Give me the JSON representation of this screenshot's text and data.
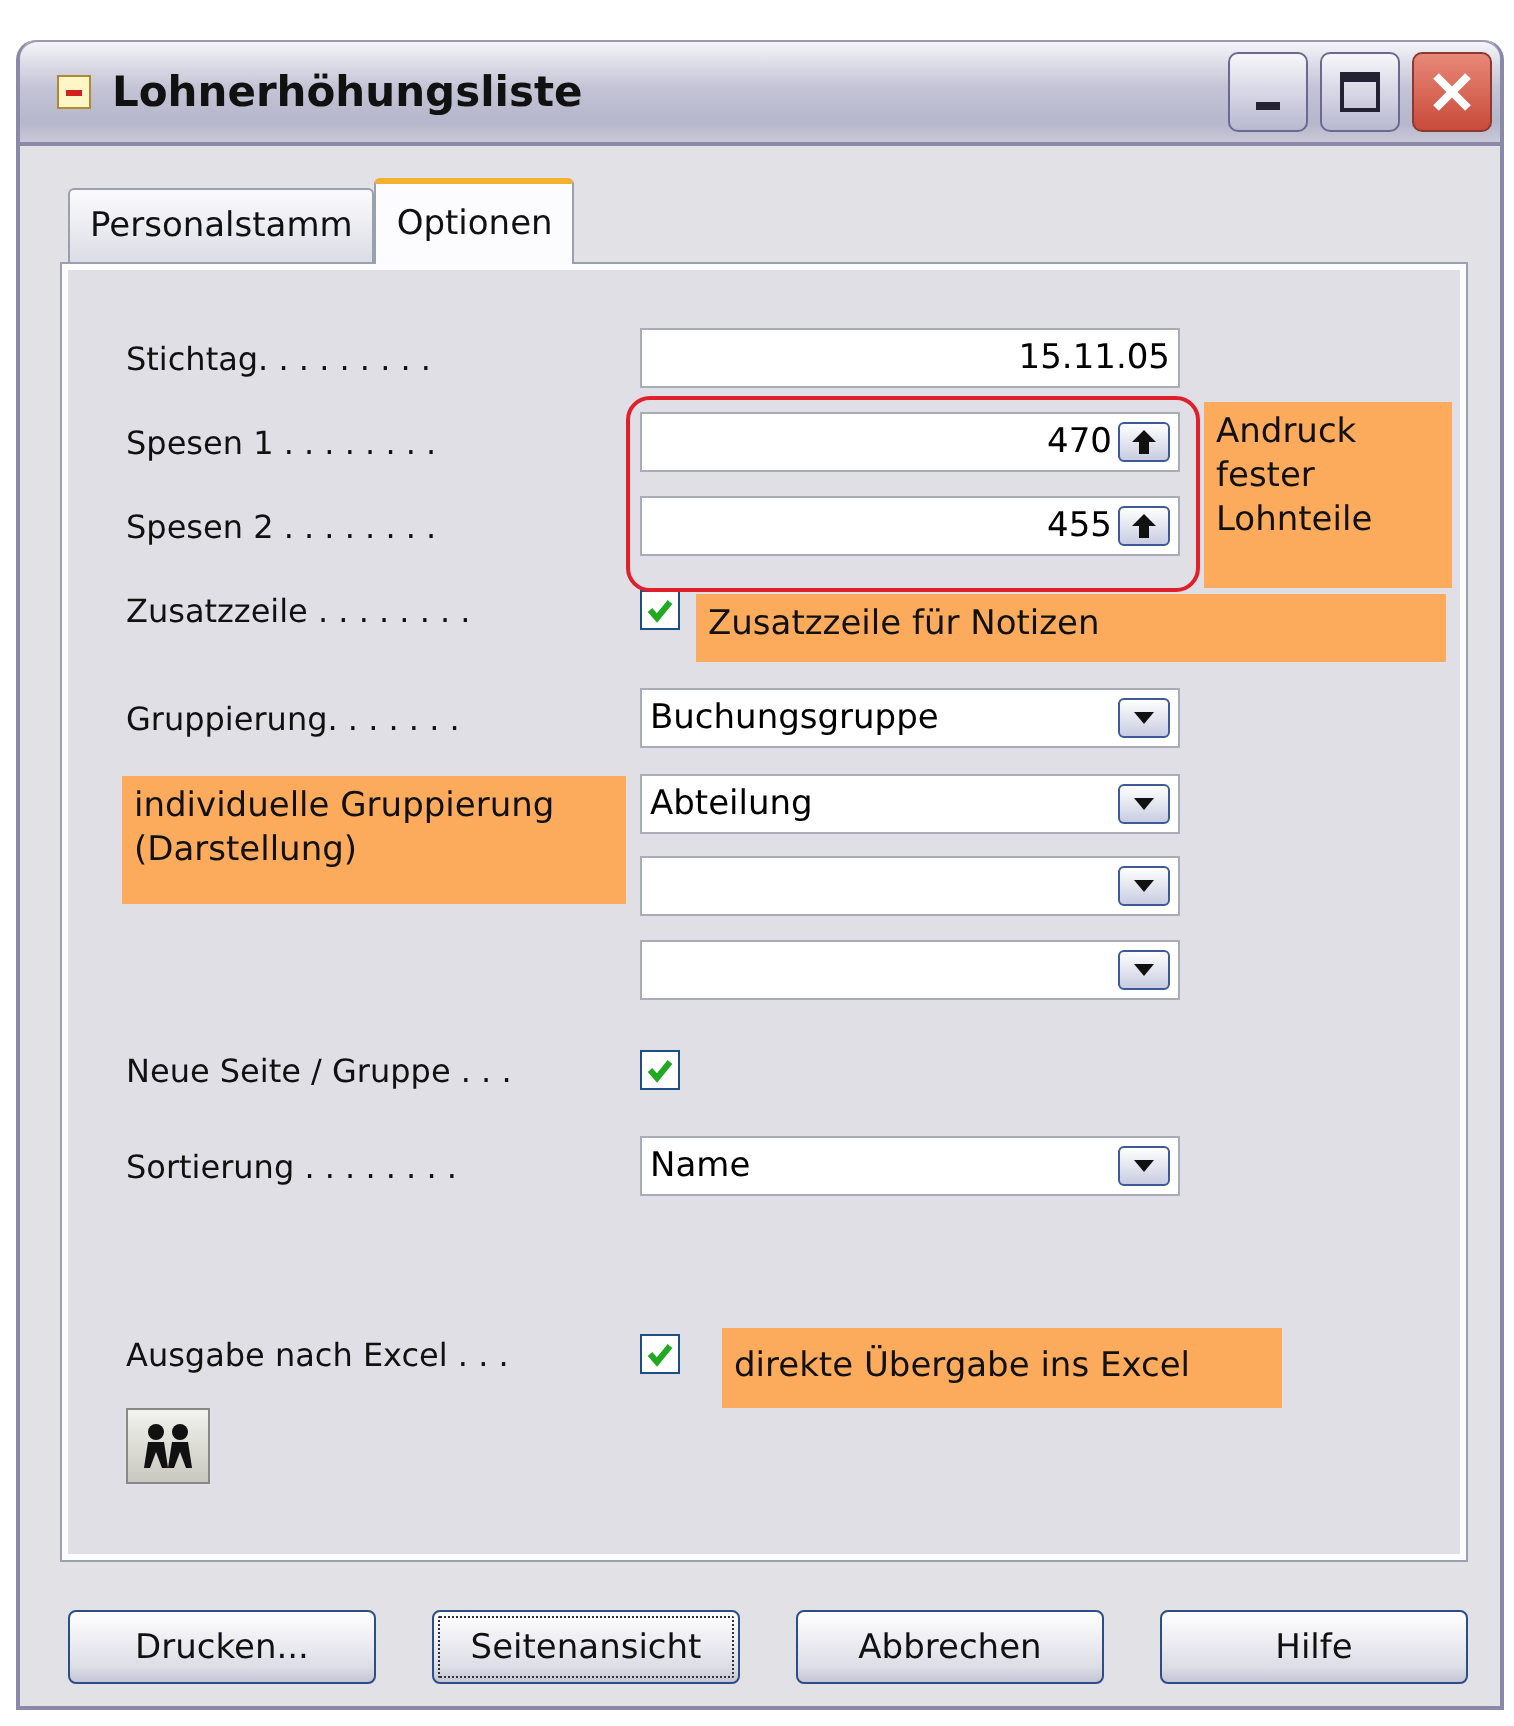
{
  "window": {
    "title": "Lohnerhöhungsliste"
  },
  "tabs": [
    {
      "label": "Personalstamm",
      "selected": false
    },
    {
      "label": "Optionen",
      "selected": true
    }
  ],
  "fields": [
    {
      "kind": "text",
      "label": "Stichtag. . . . . . . . .",
      "value": "15.11.05"
    },
    {
      "kind": "spin",
      "label": "Spesen 1 . . . . . . . .",
      "value": "470"
    },
    {
      "kind": "spin",
      "label": "Spesen 2 . . . . . . . .",
      "value": "455"
    },
    {
      "kind": "checkbox",
      "label": "Zusatzzeile . . . . . . . .",
      "checked": true
    },
    {
      "kind": "select",
      "label": "Gruppierung. . . . . . .",
      "value": "Buchungsgruppe"
    },
    {
      "kind": "select",
      "value": "Abteilung"
    },
    {
      "kind": "select"
    },
    {
      "kind": "select"
    },
    {
      "kind": "checkbox",
      "label": "Neue Seite / Gruppe . . .",
      "checked": true
    },
    {
      "kind": "select",
      "label": "Sortierung . . . . . . . .",
      "value": "Name"
    },
    {
      "kind": "checkbox",
      "label": "Ausgabe nach Excel . . .",
      "checked": true
    }
  ],
  "annotations": [
    {
      "text": "Andruck fester Lohnteile"
    },
    {
      "text": "Zusatzzeile für Notizen"
    },
    {
      "text": "individuelle Gruppierung (Darstellung)"
    },
    {
      "text": "direkte Übergabe ins Excel"
    }
  ],
  "buttons": [
    {
      "label": "Drucken...",
      "focused": false
    },
    {
      "label": "Seitenansicht",
      "focused": true
    },
    {
      "label": "Abbrechen",
      "focused": false
    },
    {
      "label": "Hilfe",
      "focused": false
    }
  ]
}
